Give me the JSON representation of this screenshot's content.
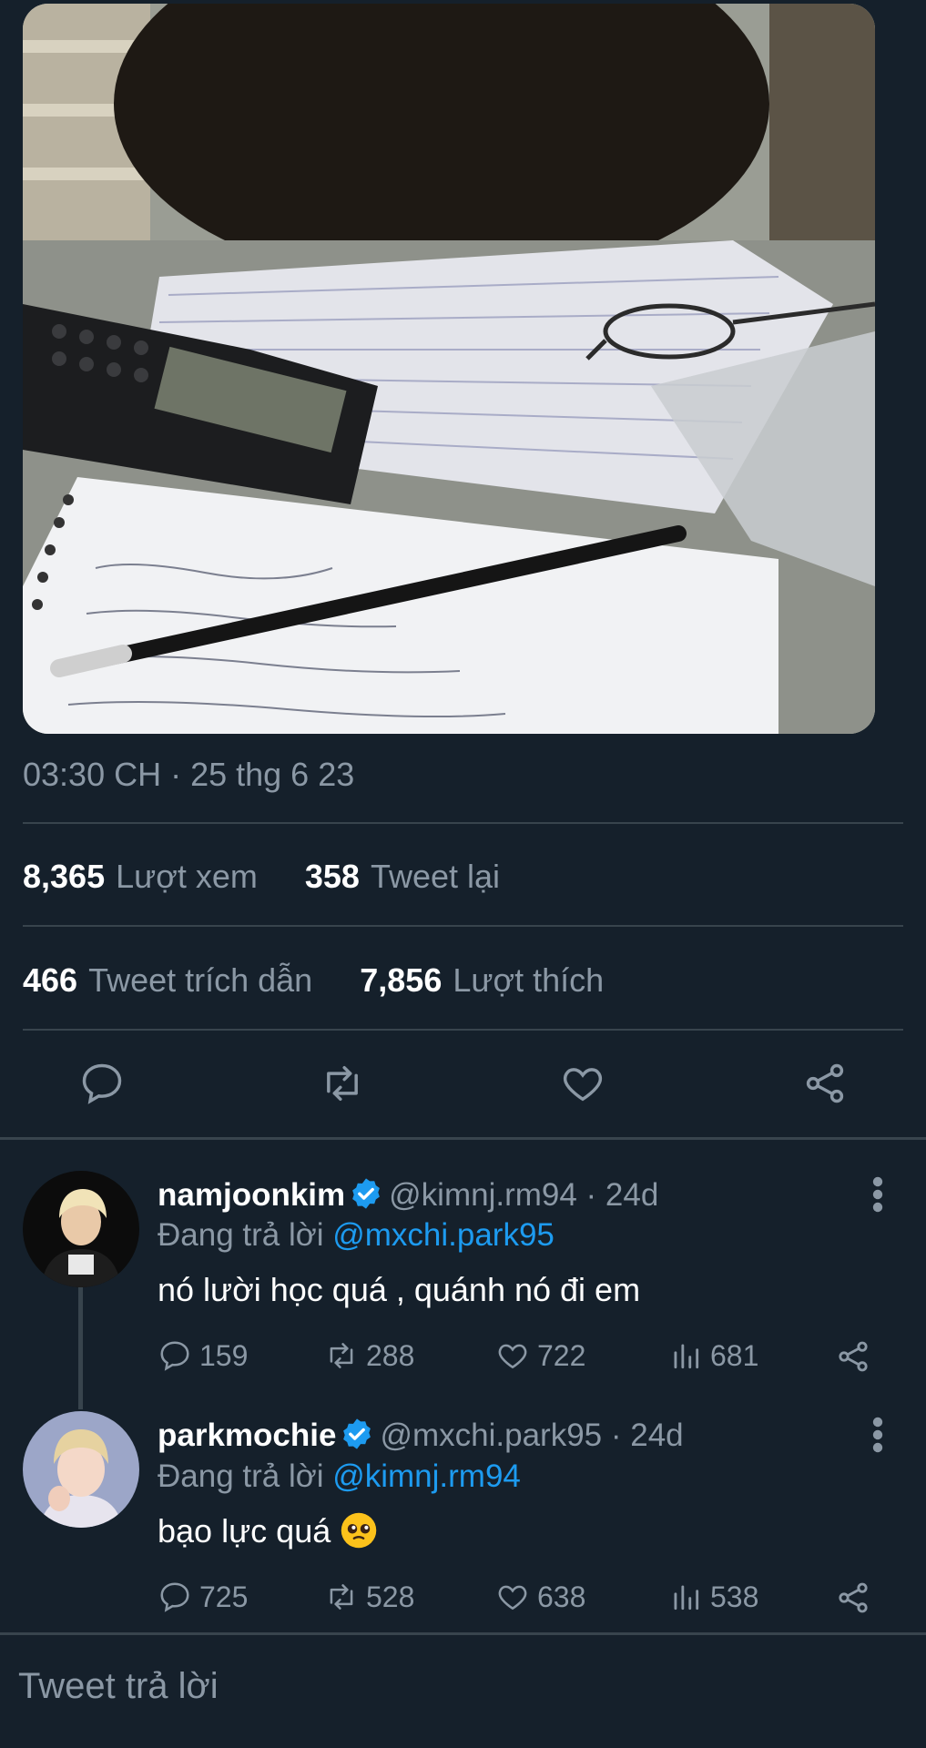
{
  "tweet": {
    "timestamp": "03:30 CH · 25 thg 6 23",
    "stats": {
      "views": {
        "value": "8,365",
        "label": "Lượt xem"
      },
      "retweets": {
        "value": "358",
        "label": "Tweet lại"
      },
      "quotes": {
        "value": "466",
        "label": "Tweet trích dẫn"
      },
      "likes": {
        "value": "7,856",
        "label": "Lượt thích"
      }
    },
    "actions": [
      "reply-icon",
      "retweet-icon",
      "like-icon",
      "share-icon"
    ]
  },
  "replies": [
    {
      "name": "namjoonkim",
      "handle": "@kimnj.rm94",
      "age": "24d",
      "reply_prefix": "Đang trả lời",
      "reply_to": "@mxchi.park95",
      "text": "nó lười học quá , quánh nó đi em",
      "replies": "159",
      "retweets": "288",
      "likes": "722",
      "views": "681"
    },
    {
      "name": "parkmochie",
      "handle": "@mxchi.park95",
      "age": "24d",
      "reply_prefix": "Đang trả lời",
      "reply_to": "@kimnj.rm94",
      "text": "bạo lực quá",
      "replies": "725",
      "retweets": "528",
      "likes": "638",
      "views": "538"
    }
  ],
  "compose": {
    "placeholder": "Tweet trả lời"
  },
  "colors": {
    "background": "#15202b",
    "muted": "#8b98a5",
    "accent": "#1d9bf0",
    "divider": "#38444d"
  }
}
